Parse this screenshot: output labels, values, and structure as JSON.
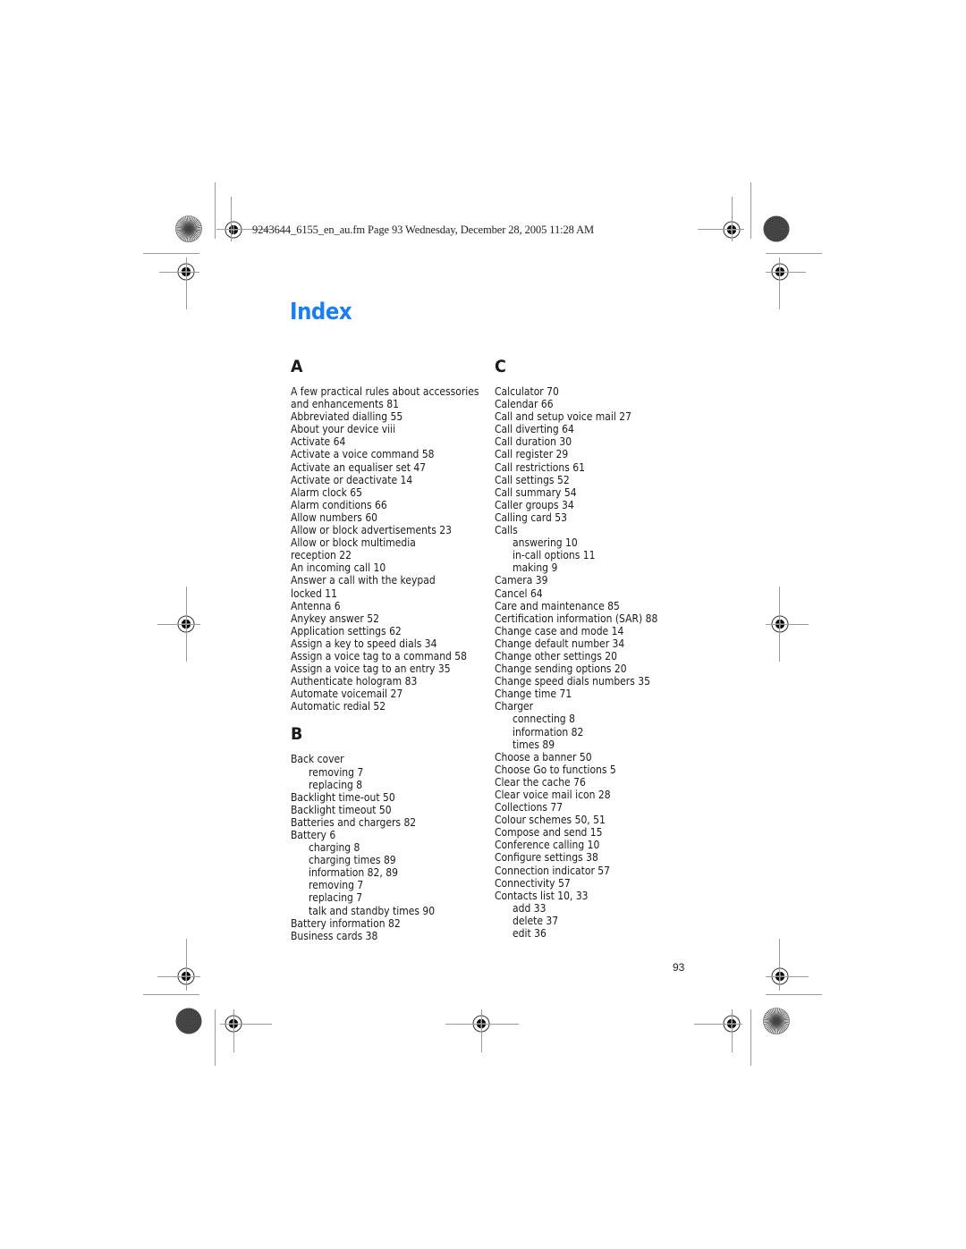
{
  "header": {
    "print_info": "9243644_6155_en_au.fm  Page 93  Wednesday, December 28, 2005  11:28 AM"
  },
  "title": "Index",
  "sections": {
    "A": {
      "letter": "A",
      "entries": [
        {
          "text": "A few practical rules about accessories",
          "sub": false
        },
        {
          "text": "and enhancements 81",
          "sub": false
        },
        {
          "text": "Abbreviated dialling 55",
          "sub": false
        },
        {
          "text": "About your device viii",
          "sub": false
        },
        {
          "text": "Activate 64",
          "sub": false
        },
        {
          "text": "Activate a voice command 58",
          "sub": false
        },
        {
          "text": "Activate an equaliser set 47",
          "sub": false
        },
        {
          "text": "Activate or deactivate 14",
          "sub": false
        },
        {
          "text": "Alarm clock 65",
          "sub": false
        },
        {
          "text": "Alarm conditions 66",
          "sub": false
        },
        {
          "text": "Allow numbers 60",
          "sub": false
        },
        {
          "text": "Allow or block advertisements 23",
          "sub": false
        },
        {
          "text": "Allow or block multimedia",
          "sub": false
        },
        {
          "text": "reception 22",
          "sub": false
        },
        {
          "text": "An incoming call 10",
          "sub": false
        },
        {
          "text": "Answer a call with the keypad",
          "sub": false
        },
        {
          "text": "locked 11",
          "sub": false
        },
        {
          "text": "Antenna 6",
          "sub": false
        },
        {
          "text": "Anykey answer 52",
          "sub": false
        },
        {
          "text": "Application settings 62",
          "sub": false
        },
        {
          "text": "Assign a key to speed dials 34",
          "sub": false
        },
        {
          "text": "Assign a voice tag to a command 58",
          "sub": false
        },
        {
          "text": "Assign a voice tag to an entry 35",
          "sub": false
        },
        {
          "text": "Authenticate hologram 83",
          "sub": false
        },
        {
          "text": "Automate voicemail 27",
          "sub": false
        },
        {
          "text": "Automatic redial 52",
          "sub": false
        }
      ]
    },
    "B": {
      "letter": "B",
      "entries": [
        {
          "text": "Back cover",
          "sub": false
        },
        {
          "text": "removing 7",
          "sub": true
        },
        {
          "text": "replacing 8",
          "sub": true
        },
        {
          "text": "Backlight time-out 50",
          "sub": false
        },
        {
          "text": "Backlight timeout 50",
          "sub": false
        },
        {
          "text": "Batteries and chargers 82",
          "sub": false
        },
        {
          "text": "Battery 6",
          "sub": false
        },
        {
          "text": "charging 8",
          "sub": true
        },
        {
          "text": "charging times 89",
          "sub": true
        },
        {
          "text": "information 82, 89",
          "sub": true
        },
        {
          "text": "removing 7",
          "sub": true
        },
        {
          "text": "replacing 7",
          "sub": true
        },
        {
          "text": "talk and standby times 90",
          "sub": true
        },
        {
          "text": "Battery information 82",
          "sub": false
        },
        {
          "text": "Business cards 38",
          "sub": false
        }
      ]
    },
    "C": {
      "letter": "C",
      "entries": [
        {
          "text": "Calculator 70",
          "sub": false
        },
        {
          "text": "Calendar 66",
          "sub": false
        },
        {
          "text": "Call and setup voice mail 27",
          "sub": false
        },
        {
          "text": "Call diverting 64",
          "sub": false
        },
        {
          "text": "Call duration 30",
          "sub": false
        },
        {
          "text": "Call register 29",
          "sub": false
        },
        {
          "text": "Call restrictions 61",
          "sub": false
        },
        {
          "text": "Call settings 52",
          "sub": false
        },
        {
          "text": "Call summary 54",
          "sub": false
        },
        {
          "text": "Caller groups 34",
          "sub": false
        },
        {
          "text": "Calling card 53",
          "sub": false
        },
        {
          "text": "Calls",
          "sub": false
        },
        {
          "text": "answering 10",
          "sub": true
        },
        {
          "text": "in-call options 11",
          "sub": true
        },
        {
          "text": "making 9",
          "sub": true
        },
        {
          "text": "Camera 39",
          "sub": false
        },
        {
          "text": "Cancel 64",
          "sub": false
        },
        {
          "text": "Care and maintenance 85",
          "sub": false
        },
        {
          "text": "Certification information (SAR) 88",
          "sub": false
        },
        {
          "text": "Change case and mode 14",
          "sub": false
        },
        {
          "text": "Change default number 34",
          "sub": false
        },
        {
          "text": "Change other settings 20",
          "sub": false
        },
        {
          "text": "Change sending options 20",
          "sub": false
        },
        {
          "text": "Change speed dials numbers 35",
          "sub": false
        },
        {
          "text": "Change time 71",
          "sub": false
        },
        {
          "text": "Charger",
          "sub": false
        },
        {
          "text": "connecting 8",
          "sub": true
        },
        {
          "text": "information 82",
          "sub": true
        },
        {
          "text": "times 89",
          "sub": true
        },
        {
          "text": "Choose a banner 50",
          "sub": false
        },
        {
          "text": "Choose Go to functions 5",
          "sub": false
        },
        {
          "text": "Clear the cache 76",
          "sub": false
        },
        {
          "text": "Clear voice mail icon 28",
          "sub": false
        },
        {
          "text": "Collections 77",
          "sub": false
        },
        {
          "text": "Colour schemes 50, 51",
          "sub": false
        },
        {
          "text": "Compose and send 15",
          "sub": false
        },
        {
          "text": "Conference calling 10",
          "sub": false
        },
        {
          "text": "Configure settings 38",
          "sub": false
        },
        {
          "text": "Connection indicator 57",
          "sub": false
        },
        {
          "text": "Connectivity 57",
          "sub": false
        },
        {
          "text": "Contacts list 10, 33",
          "sub": false
        },
        {
          "text": "add 33",
          "sub": true
        },
        {
          "text": "delete 37",
          "sub": true
        },
        {
          "text": "edit 36",
          "sub": true
        }
      ]
    }
  },
  "page_number": "93",
  "colors": {
    "title": "#1a7ff2",
    "text": "#1a1a1a",
    "crop_marks": "#9a9a9a"
  },
  "icons": {
    "registration_mark": "crosshair-circle-target",
    "color_wheel_light": "radial-starburst-wheel",
    "color_wheel_dark": "dark-gray-density-wheel"
  }
}
